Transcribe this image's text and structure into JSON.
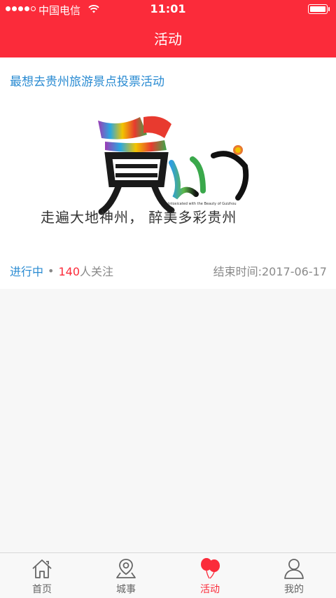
{
  "status_bar": {
    "carrier": "中国电信",
    "time": "11:01"
  },
  "header": {
    "title": "活动"
  },
  "activity": {
    "title": "最想去贵州旅游景点投票活动",
    "status": "进行中",
    "separator": "•",
    "followers_count": "140",
    "followers_suffix": "人关注",
    "end_time": "结束时间:2017-06-17",
    "banner": {
      "logo_char": "贵州",
      "tagline_en": "Intoxicated with the Beauty of Guizhou",
      "slogan": "走遍大地神州，  醉美多彩贵州"
    }
  },
  "tabbar": {
    "items": [
      {
        "label": "首页",
        "icon": "home-icon"
      },
      {
        "label": "城事",
        "icon": "location-icon"
      },
      {
        "label": "活动",
        "icon": "balloons-icon",
        "active": true
      },
      {
        "label": "我的",
        "icon": "user-icon"
      }
    ]
  },
  "colors": {
    "brand_red": "#fb2b3a",
    "link_blue": "#2a8bd2"
  }
}
